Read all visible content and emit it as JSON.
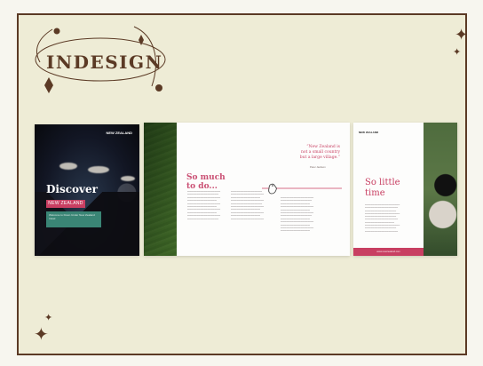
{
  "title": {
    "text": "INDESIGN"
  },
  "cover": {
    "logo_text": "NEW ZEALAND",
    "title": "Discover",
    "pill": "NEW ZEALAND",
    "teal_text": "Welcome to Down Under New Zealand travel"
  },
  "spread_two": {
    "headline_line1": "So much",
    "headline_line2": "to do...",
    "quote_line1": "“New Zealand is",
    "quote_line2": "not a small country",
    "quote_line3": "but a large village.”",
    "quote_source": "Peter Jackson"
  },
  "spread_three": {
    "logo_text": "NEW ZEALAND",
    "headline_line1": "So little",
    "headline_line2": "time",
    "footer": "www.newzealand.com"
  },
  "colors": {
    "brown": "#5b3a25",
    "pink": "#c83f62",
    "teal": "#3a8575",
    "paper": "#eeecd6"
  }
}
